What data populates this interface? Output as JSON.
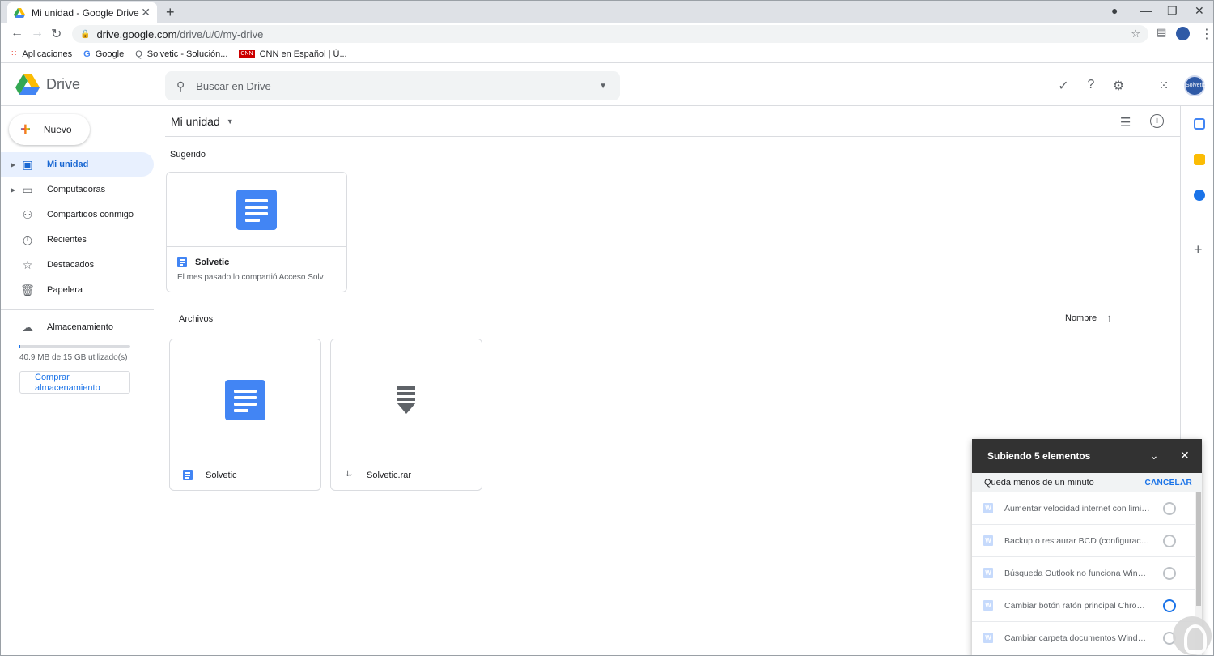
{
  "browser": {
    "tab_title": "Mi unidad - Google Drive",
    "url_host": "drive.google.com",
    "url_path": "/drive/u/0/my-drive",
    "bookmarks": [
      "Aplicaciones",
      "Google",
      "Solvetic - Solución...",
      "CNN en Español | Ú..."
    ]
  },
  "header": {
    "app_name": "Drive",
    "search_placeholder": "Buscar en Drive",
    "avatar_text": "Solvetic"
  },
  "sidebar": {
    "new_label": "Nuevo",
    "items": [
      {
        "label": "Mi unidad",
        "icon": "drive-icon"
      },
      {
        "label": "Computadoras",
        "icon": "computer-icon"
      },
      {
        "label": "Compartidos conmigo",
        "icon": "people-icon"
      },
      {
        "label": "Recientes",
        "icon": "clock-icon"
      },
      {
        "label": "Destacados",
        "icon": "star-icon"
      },
      {
        "label": "Papelera",
        "icon": "trash-icon"
      }
    ],
    "storage_label": "Almacenamiento",
    "storage_used": "40.9 MB de 15 GB utilizado(s)",
    "storage_fraction": 0.003,
    "buy_label_1": "Comprar",
    "buy_label_2": "almacenamiento"
  },
  "main": {
    "breadcrumb": "Mi unidad",
    "suggested_title": "Sugerido",
    "suggested": {
      "name": "Solvetic",
      "sub": "El mes pasado lo compartió Acceso Solv"
    },
    "files_title": "Archivos",
    "sort_label": "Nombre",
    "files": [
      {
        "name": "Solvetic",
        "type": "doc"
      },
      {
        "name": "Solvetic.rar",
        "type": "rar"
      }
    ]
  },
  "upload": {
    "title": "Subiendo 5 elementos",
    "status": "Queda menos de un minuto",
    "cancel": "CANCELAR",
    "items": [
      "Aumentar velocidad internet con limit...",
      "Backup o restaurar BCD (configuració...",
      "Búsqueda Outlook no funciona Windo...",
      "Cambiar botón ratón principal Chrome...",
      "Cambiar carpeta documentos Window..."
    ]
  }
}
